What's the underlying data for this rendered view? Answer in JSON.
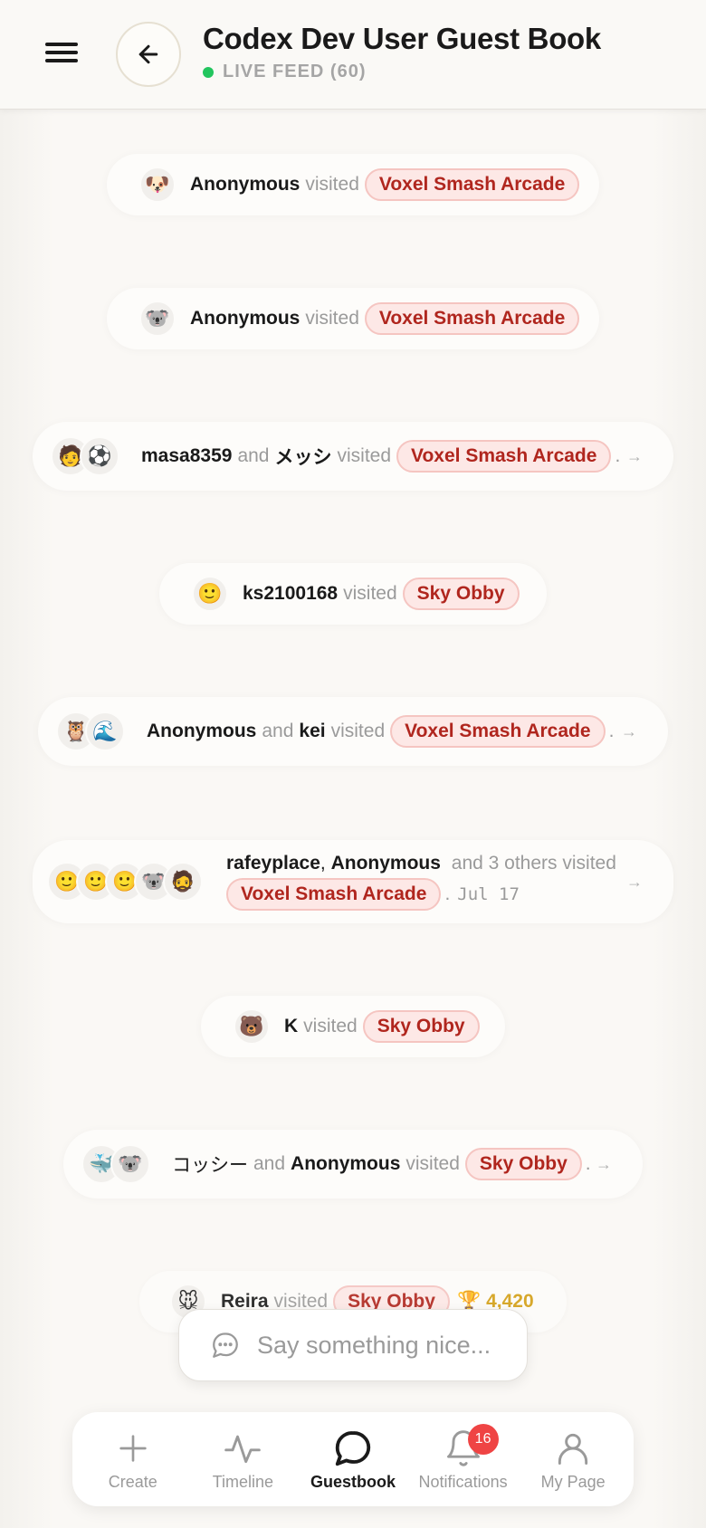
{
  "header": {
    "title": "Codex Dev User Guest Book",
    "live_label": "LIVE FEED (60)",
    "live_color": "#22c55e"
  },
  "feed": [
    {
      "users": [
        "Anonymous"
      ],
      "verb": "visited",
      "game": "Voxel Smash Arcade",
      "avatars": [
        "🐶"
      ]
    },
    {
      "users": [
        "Anonymous"
      ],
      "verb": "visited",
      "game": "Voxel Smash Arcade",
      "avatars": [
        "🐨"
      ]
    },
    {
      "users": [
        "masa8359",
        "メッシ"
      ],
      "joiner": "and",
      "verb": "visited",
      "game": "Voxel Smash Arcade",
      "suffix": ".",
      "avatars": [
        "🧑",
        "⚽"
      ]
    },
    {
      "users": [
        "ks2100168"
      ],
      "verb": "visited",
      "game": "Sky Obby",
      "avatars": [
        "🙂"
      ]
    },
    {
      "users": [
        "Anonymous",
        "kei"
      ],
      "joiner": "and",
      "verb": "visited",
      "game": "Voxel Smash Arcade",
      "suffix": ".",
      "avatars": [
        "🦉",
        "🌊"
      ]
    },
    {
      "users": [
        "rafeyplace",
        "Anonymous"
      ],
      "joiner": ",",
      "others": "and 3 others visited",
      "game": "Voxel Smash Arcade",
      "suffix": ".",
      "date": "Jul 17",
      "avatars": [
        "🙂",
        "🙂",
        "🙂",
        "🐨",
        "🧔"
      ]
    },
    {
      "users": [
        "K"
      ],
      "verb": "visited",
      "game": "Sky Obby",
      "avatars": [
        "🐻"
      ]
    },
    {
      "users": [
        "コッシー",
        "Anonymous"
      ],
      "joiner": "and",
      "verb": "visited",
      "game": "Sky Obby",
      "suffix": ".",
      "avatars": [
        "🐳",
        "🐨"
      ]
    },
    {
      "users": [
        "Reira"
      ],
      "verb": "visited",
      "game": "Sky Obby",
      "trophy": "🏆",
      "score": "4,420",
      "avatars": [
        "🐭"
      ]
    }
  ],
  "compose": {
    "placeholder": "Say something nice...",
    "icon": "chat-bubble-icon"
  },
  "nav": [
    {
      "label": "Create",
      "icon": "plus-icon"
    },
    {
      "label": "Timeline",
      "icon": "activity-icon"
    },
    {
      "label": "Guestbook",
      "icon": "chat-icon",
      "active": true
    },
    {
      "label": "Notifications",
      "icon": "bell-icon",
      "badge": "16"
    },
    {
      "label": "My Page",
      "icon": "user-icon"
    }
  ],
  "colors": {
    "accent_badge": "#ef4444",
    "game_text": "#b0261e",
    "game_bg": "#fde8e6",
    "trophy": "#d4a017"
  }
}
